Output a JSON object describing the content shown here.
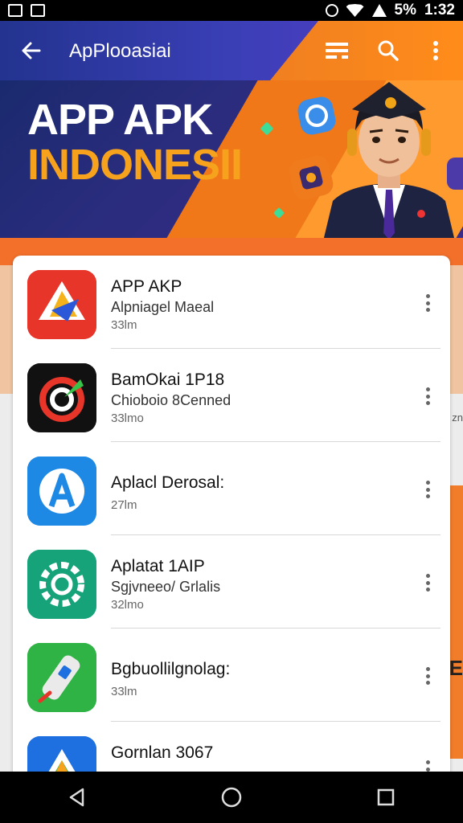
{
  "status_bar": {
    "battery": "5%",
    "time": "1:32"
  },
  "app_bar": {
    "title": "ApPlooasiai"
  },
  "banner": {
    "line1": "APP APK",
    "line2": "INDONESII"
  },
  "apps": [
    {
      "name": "APP AKP",
      "subtitle": "Alpniagel Maeal",
      "size": "33lm",
      "icon": "red-arrow-app-icon",
      "color": "#e8352a"
    },
    {
      "name": "BamOkai 1P18",
      "subtitle": "Chioboio 8Cenned",
      "size": "33lmo",
      "icon": "black-ring-app-icon",
      "color": "#111111"
    },
    {
      "name": "Aplacl Derosal:",
      "subtitle": "",
      "size": "27lm",
      "icon": "blue-a-app-icon",
      "color": "#1e88e5"
    },
    {
      "name": "Aplatat 1AIP",
      "subtitle": "Sgjvneeo/ Grlalis",
      "size": "32lmo",
      "icon": "green-gear-app-icon",
      "color": "#17a37a"
    },
    {
      "name": "Bgbuollilgnolag:",
      "subtitle": "",
      "size": "33lm",
      "icon": "green-remote-app-icon",
      "color": "#2fb344"
    },
    {
      "name": "Gornlan 3067",
      "subtitle": "",
      "size": "",
      "icon": "blue-triangle-app-icon",
      "color": "#1e6fe0"
    }
  ],
  "side_text": {
    "small": "zn",
    "large": "RE"
  },
  "colors": {
    "app_bar": "#2e3aa3",
    "accent": "#f07f20",
    "banner_text_secondary": "#f6a21c"
  }
}
